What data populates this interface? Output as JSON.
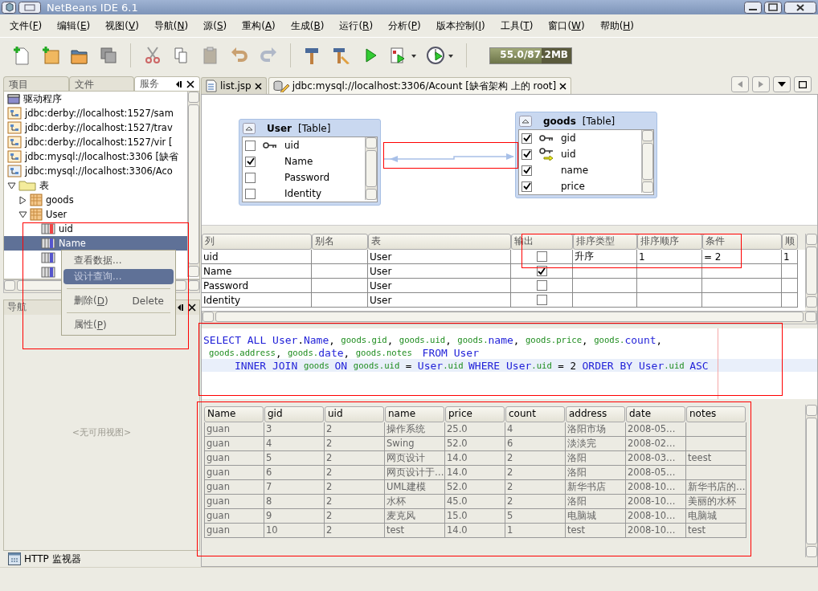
{
  "window": {
    "title": "NetBeans IDE 6.1"
  },
  "menu": [
    "文件(F)",
    "编辑(E)",
    "视图(V)",
    "导航(N)",
    "源(S)",
    "重构(A)",
    "生成(B)",
    "运行(R)",
    "分析(P)",
    "版本控制(I)",
    "工具(T)",
    "窗口(W)",
    "帮助(H)"
  ],
  "memory": {
    "text": "55.0/87.2MB",
    "level": 0.63
  },
  "left_tabs": [
    {
      "label": "项目",
      "selected": false
    },
    {
      "label": "文件",
      "selected": false
    },
    {
      "label": "服务",
      "selected": true
    }
  ],
  "tree": [
    {
      "label": "驱动程序",
      "kind": "driver",
      "selected": false
    },
    {
      "label": "jdbc:derby://localhost:1527/sam",
      "kind": "connection",
      "selected": false
    },
    {
      "label": "jdbc:derby://localhost:1527/trav",
      "kind": "connection",
      "selected": false
    },
    {
      "label": "jdbc:derby://localhost:1527/vir [",
      "kind": "connection",
      "selected": false
    },
    {
      "label": "jdbc:mysql://localhost:3306 [缺省",
      "kind": "connection",
      "selected": false
    },
    {
      "label": "jdbc:mysql://localhost:3306/Aco",
      "kind": "connected",
      "selected": false
    },
    {
      "label": "表",
      "kind": "folder",
      "selected": false,
      "expanded": true,
      "children": [
        {
          "label": "goods",
          "kind": "table",
          "selected": false,
          "expanded": false
        },
        {
          "label": "User",
          "kind": "table",
          "selected": false,
          "expanded": true,
          "children": [
            {
              "label": "uid",
              "kind": "key-column",
              "selected": false
            },
            {
              "label": "Name",
              "kind": "column",
              "selected": true
            },
            {
              "kind": "column",
              "selected": false
            },
            {
              "kind": "column",
              "selected": false
            }
          ]
        }
      ]
    }
  ],
  "context_menu": [
    {
      "kind": "item",
      "label": "查看数据...",
      "selected": false,
      "mnemonic": false
    },
    {
      "kind": "item",
      "label": "设计查询...",
      "selected": true,
      "mnemonic": false
    },
    {
      "kind": "separator"
    },
    {
      "kind": "item",
      "label": "删除(D)",
      "shortcut": "Delete",
      "selected": false,
      "mnemonic": true
    },
    {
      "kind": "separator"
    },
    {
      "kind": "item",
      "label": "属性(P)",
      "selected": false,
      "mnemonic": true
    }
  ],
  "navigator": {
    "title": "导航",
    "empty_text": "<无可用视图>"
  },
  "http_monitor": {
    "label": "HTTP 监视器"
  },
  "editor_tabs": [
    {
      "label": "list.jsp",
      "kind": "jsp",
      "selected": false
    },
    {
      "label": "jdbc:mysql://localhost:3306/Acount [缺省架构 上的 root]",
      "kind": "sql",
      "selected": true
    }
  ],
  "diagram_tables": [
    {
      "name": "User",
      "type": "[Table]",
      "columns": [
        {
          "name": "uid",
          "checked": false,
          "kind": "primary-key"
        },
        {
          "name": "Name",
          "checked": true,
          "kind": "plain"
        },
        {
          "name": "Password",
          "checked": false,
          "kind": "plain"
        },
        {
          "name": "Identity",
          "checked": false,
          "kind": "plain"
        }
      ]
    },
    {
      "name": "goods",
      "type": "[Table]",
      "columns": [
        {
          "name": "gid",
          "checked": true,
          "kind": "primary-key"
        },
        {
          "name": "uid",
          "checked": true,
          "kind": "foreign-key"
        },
        {
          "name": "name",
          "checked": true,
          "kind": "plain"
        },
        {
          "name": "price",
          "checked": true,
          "kind": "plain"
        }
      ]
    }
  ],
  "grid": {
    "columns": [
      "列",
      "别名",
      "表",
      "输出",
      "排序类型",
      "排序顺序",
      "条件",
      "顺"
    ],
    "rows": [
      {
        "column": "uid",
        "table": "User",
        "output": false,
        "sort_type": "升序",
        "sort_order": "1",
        "criteria": "= 2",
        "column_8": "1"
      },
      {
        "column": "Name",
        "table": "User",
        "output": true
      },
      {
        "column": "Password",
        "table": "User",
        "output": false
      },
      {
        "column": "Identity",
        "table": "User",
        "output": false
      }
    ]
  },
  "sql": [
    {
      "current": false,
      "tokens": [
        {
          "kind": "keyword",
          "text": "SELECT ALL User"
        },
        {
          "kind": "plain",
          "text": "."
        },
        {
          "kind": "keyword",
          "text": "Name"
        },
        {
          "kind": "plain",
          "text": ", "
        },
        {
          "kind": "identifier",
          "text": "goods.gid"
        },
        {
          "kind": "plain",
          "text": ", "
        },
        {
          "kind": "identifier",
          "text": "goods.uid"
        },
        {
          "kind": "plain",
          "text": ", "
        },
        {
          "kind": "identifier",
          "text": "goods."
        },
        {
          "kind": "keyword",
          "text": "name"
        },
        {
          "kind": "plain",
          "text": ", "
        },
        {
          "kind": "identifier",
          "text": "goods.price"
        },
        {
          "kind": "plain",
          "text": ", "
        },
        {
          "kind": "identifier",
          "text": "goods."
        },
        {
          "kind": "keyword",
          "text": "count"
        },
        {
          "kind": "plain",
          "text": ","
        }
      ]
    },
    {
      "current": false,
      "tokens": [
        {
          "kind": "identifier",
          "text": "goods.address"
        },
        {
          "kind": "plain",
          "text": ", "
        },
        {
          "kind": "identifier",
          "text": "goods."
        },
        {
          "kind": "keyword",
          "text": "date"
        },
        {
          "kind": "plain",
          "text": ", "
        },
        {
          "kind": "identifier",
          "text": "goods.notes  "
        },
        {
          "kind": "keyword",
          "text": "FROM User"
        }
      ]
    },
    {
      "current": true,
      "tokens": [
        {
          "kind": "keyword",
          "text": "INNER JOIN "
        },
        {
          "kind": "identifier",
          "text": "goods "
        },
        {
          "kind": "keyword",
          "text": "ON "
        },
        {
          "kind": "identifier",
          "text": "goods.uid"
        },
        {
          "kind": "plain",
          "text": " = "
        },
        {
          "kind": "keyword",
          "text": "User"
        },
        {
          "kind": "identifier",
          "text": ".uid "
        },
        {
          "kind": "keyword",
          "text": "WHERE User"
        },
        {
          "kind": "identifier",
          "text": ".uid"
        },
        {
          "kind": "plain",
          "text": " = 2 "
        },
        {
          "kind": "keyword",
          "text": "ORDER BY User"
        },
        {
          "kind": "identifier",
          "text": ".uid "
        },
        {
          "kind": "keyword",
          "text": "ASC"
        }
      ]
    }
  ],
  "results": {
    "columns": [
      "Name",
      "gid",
      "uid",
      "name",
      "price",
      "count",
      "address",
      "date",
      "notes"
    ],
    "rows": [
      [
        "guan",
        "3",
        "2",
        "操作系统",
        "25.0",
        "4",
        "洛阳市场",
        "2008-05…",
        null
      ],
      [
        "guan",
        "4",
        "2",
        "Swing",
        "52.0",
        "6",
        "淡淡完",
        "2008-02…",
        null
      ],
      [
        "guan",
        "5",
        "2",
        "网页设计",
        "14.0",
        "2",
        "洛阳",
        "2008-03…",
        "teest"
      ],
      [
        "guan",
        "6",
        "2",
        "网页设计于…",
        "14.0",
        "2",
        "洛阳",
        "2008-05…",
        null
      ],
      [
        "guan",
        "7",
        "2",
        "UML建模",
        "52.0",
        "2",
        "新华书店",
        "2008-10…",
        "新华书店的…"
      ],
      [
        "guan",
        "8",
        "2",
        "水杯",
        "45.0",
        "2",
        "洛阳",
        "2008-10…",
        "美丽的水杯"
      ],
      [
        "guan",
        "9",
        "2",
        "麦克风",
        "15.0",
        "5",
        "电脑城",
        "2008-10…",
        "电脑城"
      ],
      [
        "guan",
        "10",
        "2",
        "test",
        "14.0",
        "1",
        "test",
        "2008-10…",
        "test"
      ]
    ]
  }
}
